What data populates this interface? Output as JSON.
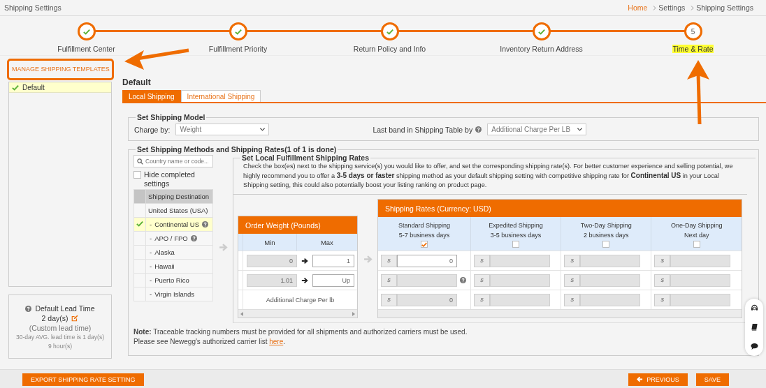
{
  "page_title": "Shipping Settings",
  "breadcrumb": [
    {
      "label": "Home",
      "kind": "link"
    },
    {
      "label": "Settings",
      "kind": "crumb"
    },
    {
      "label": "Shipping Settings",
      "kind": "crumb"
    }
  ],
  "steps": [
    {
      "label": "Fulfillment Center",
      "done": true,
      "selected": false
    },
    {
      "label": "Fulfillment Priority",
      "done": true,
      "selected": false
    },
    {
      "label": "Return Policy and Info",
      "done": true,
      "selected": false
    },
    {
      "label": "Inventory Return Address",
      "done": true,
      "selected": false
    },
    {
      "label": "Time & Rate",
      "done": false,
      "number": "5",
      "selected": true
    }
  ],
  "templates": {
    "title": "MANAGE SHIPPING TEMPLATES",
    "items": [
      {
        "label": "Default",
        "selected": true
      }
    ]
  },
  "lead_time": {
    "title": "Default Lead Time",
    "value": "2 day(s)",
    "note": "(Custom lead time)",
    "average": "30-day AVG. lead time is 1 day(s) 9 hour(s)"
  },
  "template_name": "Default",
  "tabs": [
    {
      "label": "Local Shipping",
      "selected": true
    },
    {
      "label": "International Shipping",
      "selected": false
    }
  ],
  "shipping_model": {
    "title": "Set Shipping Model",
    "charge_by_label": "Charge by:",
    "charge_by": "Weight",
    "last_band_label": "Last band in Shipping Table by",
    "last_band": "Additional Charge Per LB"
  },
  "methods": {
    "title": "Set Shipping Methods and Shipping Rates(1 of 1 is done)",
    "search_placeholder": "Country name or code...",
    "hide_completed": {
      "label": "Hide completed settings",
      "checked": false
    },
    "destination_header": "Shipping Destination",
    "destinations": [
      {
        "label": "United States (USA)",
        "kind": "country",
        "done": false,
        "selected": false,
        "help": false
      },
      {
        "prefix": "-",
        "label": "Continental US",
        "kind": "region",
        "done": true,
        "selected": true,
        "help": true
      },
      {
        "prefix": "-",
        "label": "APO / FPO",
        "kind": "region",
        "done": false,
        "selected": false,
        "help": true
      },
      {
        "prefix": "-",
        "label": "Alaska",
        "kind": "region",
        "done": false,
        "selected": false,
        "help": false
      },
      {
        "prefix": "-",
        "label": "Hawaii",
        "kind": "region",
        "done": false,
        "selected": false,
        "help": false
      },
      {
        "prefix": "-",
        "label": "Puerto Rico",
        "kind": "region",
        "done": false,
        "selected": false,
        "help": false
      },
      {
        "prefix": "-",
        "label": "Virgin Islands",
        "kind": "region",
        "done": false,
        "selected": false,
        "help": false
      }
    ],
    "local_title": "Set Local Fulfillment Shipping Rates",
    "local_description": "Check the box(es) next to the shipping service(s) you would like to offer, and set the corresponding shipping rate(s). For better customer experience and selling potential, we highly recommend you to offer a **3-5 days or faster** shipping method as your default shipping setting with competitive shipping rate for **Continental US** in your Local Shipping setting, this could also potentially boost your listing ranking on product page.",
    "weight": {
      "title": "Order Weight (Pounds)",
      "columns": [
        "Min",
        "Max"
      ],
      "rows": [
        {
          "kind": "range",
          "min": "0",
          "max": "1"
        },
        {
          "kind": "range",
          "min": "1.01",
          "max_placeholder": "Up"
        },
        {
          "kind": "additional",
          "label": "Additional Charge Per lb"
        }
      ]
    },
    "rates": {
      "title": "Shipping Rates (Currency: USD)",
      "services": [
        {
          "name": "Standard Shipping",
          "days": "5-7 business days",
          "checked": true,
          "rates": [
            {
              "currency": "$",
              "value": "0",
              "disabled": false,
              "help": false
            },
            {
              "currency": "$",
              "disabled": true,
              "help": true
            },
            {
              "currency": "$",
              "value": "0",
              "disabled": true,
              "help": false
            }
          ]
        },
        {
          "name": "Expedited Shipping",
          "days": "3-5 business days",
          "checked": false,
          "rates": [
            {
              "currency": "$",
              "disabled": true,
              "help": false
            },
            {
              "currency": "$",
              "disabled": true,
              "help": false
            },
            {
              "currency": "$",
              "disabled": true,
              "help": false
            }
          ]
        },
        {
          "name": "Two-Day Shipping",
          "days": "2 business days",
          "checked": false,
          "rates": [
            {
              "currency": "$",
              "disabled": true,
              "help": false
            },
            {
              "currency": "$",
              "disabled": true,
              "help": false
            },
            {
              "currency": "$",
              "disabled": true,
              "help": false
            }
          ]
        },
        {
          "name": "One-Day Shipping",
          "days": "Next day",
          "checked": false,
          "rates": [
            {
              "currency": "$",
              "disabled": true,
              "help": false
            },
            {
              "currency": "$",
              "disabled": true,
              "help": false
            },
            {
              "currency": "$",
              "disabled": true,
              "help": false
            }
          ]
        }
      ]
    },
    "note": "**Note:** Traceable tracking numbers must be provided for all shipments and authorized carriers must be used.",
    "carrier": {
      "text": "Please see Newegg's authorized carrier list",
      "link": "here",
      "after": "."
    }
  },
  "actions": {
    "export": "EXPORT SHIPPING RATE SETTING",
    "previous": "PREVIOUS",
    "save": "SAVE"
  }
}
